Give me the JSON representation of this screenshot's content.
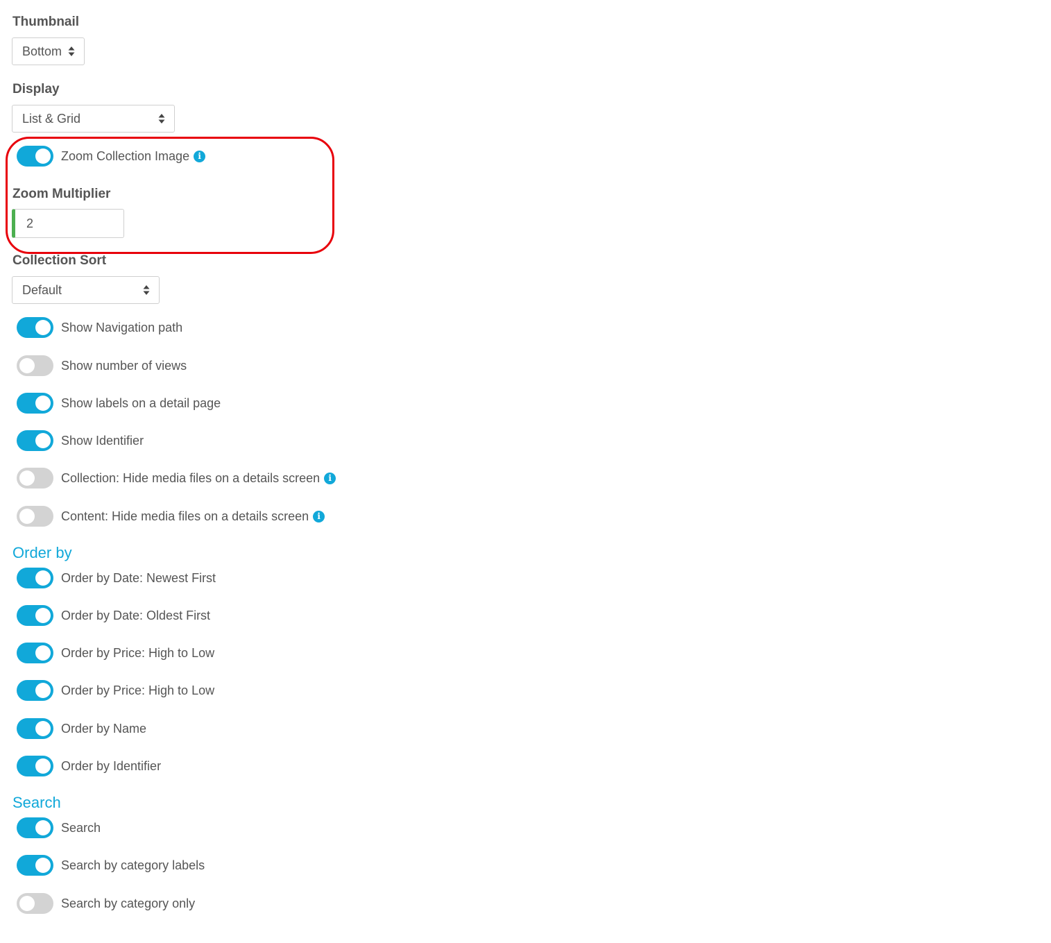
{
  "thumbnail": {
    "label": "Thumbnail",
    "value": "Bottom"
  },
  "display": {
    "label": "Display",
    "value": "List & Grid"
  },
  "zoom_collection_image": {
    "label": "Zoom Collection Image",
    "enabled": true
  },
  "zoom_multiplier": {
    "label": "Zoom Multiplier",
    "value": "2"
  },
  "collection_sort": {
    "label": "Collection Sort",
    "value": "Default"
  },
  "general_toggles": [
    {
      "label": "Show Navigation path",
      "enabled": true,
      "info": false
    },
    {
      "label": "Show number of views",
      "enabled": false,
      "info": false
    },
    {
      "label": "Show labels on a detail page",
      "enabled": true,
      "info": false
    },
    {
      "label": "Show Identifier",
      "enabled": true,
      "info": false
    },
    {
      "label": "Collection: Hide media files on a details screen",
      "enabled": false,
      "info": true
    },
    {
      "label": "Content: Hide media files on a details screen",
      "enabled": false,
      "info": true
    }
  ],
  "order_by": {
    "heading": "Order by",
    "items": [
      {
        "label": "Order by Date: Newest First",
        "enabled": true
      },
      {
        "label": "Order by Date: Oldest First",
        "enabled": true
      },
      {
        "label": "Order by Price: High to Low",
        "enabled": true
      },
      {
        "label": "Order by Price: High to Low",
        "enabled": true
      },
      {
        "label": "Order by Name",
        "enabled": true
      },
      {
        "label": "Order by Identifier",
        "enabled": true
      }
    ]
  },
  "search": {
    "heading": "Search",
    "items": [
      {
        "label": "Search",
        "enabled": true
      },
      {
        "label": "Search by category labels",
        "enabled": true
      },
      {
        "label": "Search by category only",
        "enabled": false
      }
    ]
  },
  "colors": {
    "accent": "#11a8d9",
    "toggle_off": "#d3d3d3",
    "highlight": "#e8000b",
    "input_focus": "#4caf50"
  },
  "icons": {
    "info": "info-icon",
    "select_arrows": "sort-arrows-icon"
  }
}
